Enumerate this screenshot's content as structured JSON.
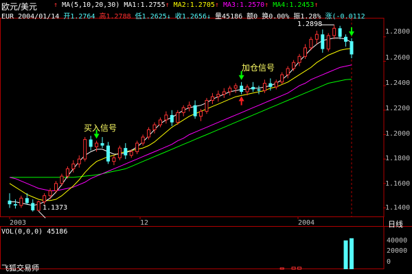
{
  "header": {
    "title": "欧元/美元",
    "ma_label": "MA(5,10,20,30)",
    "ma1": "MA1:1.2755",
    "ma2": "MA2:1.2705",
    "ma3": "MA3:1.2570",
    "ma4": "MA4:1.2453",
    "symbol": "EUR",
    "date": "2004/01/14",
    "open": "开1.2764",
    "high": "高1.2788",
    "low": "低1.2625",
    "close": "收1.2656",
    "volume": "量45186",
    "amount": "额0",
    "turnover": "换0.00%",
    "amplitude": "振1.28%",
    "change": "涨(-0.0112"
  },
  "price_axis": [
    "1.2800",
    "1.2600",
    "1.2400",
    "1.2200",
    "1.2000",
    "1.1800",
    "1.1600",
    "1.1400"
  ],
  "annotations": {
    "buy": "买入信号",
    "add": "加仓信号",
    "high_mark": "1.2898",
    "low_mark": "1.1373"
  },
  "x_axis": [
    "2003",
    "12",
    "2004"
  ],
  "period": "日线",
  "volume_panel": {
    "label": "VOL(0,0,0)",
    "value": "45186",
    "axis": [
      "40000",
      "20000",
      "0"
    ]
  },
  "footer": "飞狐交易师",
  "colors": {
    "up": "#ff3232",
    "down": "#54fcfc",
    "ma1": "#ffffff",
    "ma2": "#ffff00",
    "ma3": "#ff00ff",
    "ma4": "#00ff00",
    "frame": "#b00000"
  },
  "chart_data": {
    "type": "candlestick",
    "ylim": [
      1.133,
      1.295
    ],
    "ohlc": [
      [
        1.146,
        1.152,
        1.14,
        1.143
      ],
      [
        1.143,
        1.147,
        1.1395,
        1.142
      ],
      [
        1.142,
        1.15,
        1.14,
        1.148
      ],
      [
        1.148,
        1.152,
        1.143,
        1.144
      ],
      [
        1.144,
        1.147,
        1.137,
        1.138
      ],
      [
        1.138,
        1.146,
        1.1373,
        1.145
      ],
      [
        1.145,
        1.152,
        1.143,
        1.15
      ],
      [
        1.15,
        1.156,
        1.147,
        1.154
      ],
      [
        1.154,
        1.162,
        1.152,
        1.16
      ],
      [
        1.16,
        1.168,
        1.158,
        1.166
      ],
      [
        1.166,
        1.174,
        1.164,
        1.172
      ],
      [
        1.172,
        1.179,
        1.169,
        1.176
      ],
      [
        1.176,
        1.183,
        1.173,
        1.18
      ],
      [
        1.18,
        1.198,
        1.178,
        1.196
      ],
      [
        1.196,
        1.199,
        1.187,
        1.19
      ],
      [
        1.19,
        1.195,
        1.186,
        1.193
      ],
      [
        1.193,
        1.198,
        1.189,
        1.191
      ],
      [
        1.191,
        1.194,
        1.176,
        1.178
      ],
      [
        1.178,
        1.183,
        1.175,
        1.181
      ],
      [
        1.181,
        1.191,
        1.179,
        1.189
      ],
      [
        1.189,
        1.193,
        1.18,
        1.183
      ],
      [
        1.183,
        1.188,
        1.181,
        1.186
      ],
      [
        1.186,
        1.195,
        1.184,
        1.193
      ],
      [
        1.193,
        1.2,
        1.191,
        1.198
      ],
      [
        1.198,
        1.206,
        1.196,
        1.204
      ],
      [
        1.204,
        1.21,
        1.201,
        1.208
      ],
      [
        1.208,
        1.214,
        1.206,
        1.212
      ],
      [
        1.212,
        1.219,
        1.209,
        1.216
      ],
      [
        1.216,
        1.22,
        1.207,
        1.21
      ],
      [
        1.21,
        1.22,
        1.208,
        1.218
      ],
      [
        1.218,
        1.224,
        1.215,
        1.222
      ],
      [
        1.222,
        1.227,
        1.219,
        1.224
      ],
      [
        1.224,
        1.228,
        1.213,
        1.215
      ],
      [
        1.215,
        1.221,
        1.211,
        1.219
      ],
      [
        1.219,
        1.23,
        1.217,
        1.228
      ],
      [
        1.228,
        1.234,
        1.225,
        1.231
      ],
      [
        1.231,
        1.236,
        1.227,
        1.233
      ],
      [
        1.233,
        1.238,
        1.23,
        1.235
      ],
      [
        1.235,
        1.24,
        1.232,
        1.238
      ],
      [
        1.238,
        1.242,
        1.234,
        1.24
      ],
      [
        1.24,
        1.243,
        1.233,
        1.235
      ],
      [
        1.235,
        1.241,
        1.232,
        1.239
      ],
      [
        1.239,
        1.243,
        1.235,
        1.237
      ],
      [
        1.237,
        1.24,
        1.233,
        1.236
      ],
      [
        1.236,
        1.245,
        1.234,
        1.242
      ],
      [
        1.242,
        1.246,
        1.236,
        1.239
      ],
      [
        1.239,
        1.245,
        1.237,
        1.243
      ],
      [
        1.243,
        1.251,
        1.241,
        1.249
      ],
      [
        1.249,
        1.256,
        1.246,
        1.254
      ],
      [
        1.254,
        1.261,
        1.252,
        1.259
      ],
      [
        1.259,
        1.266,
        1.256,
        1.264
      ],
      [
        1.264,
        1.274,
        1.262,
        1.271
      ],
      [
        1.271,
        1.28,
        1.269,
        1.278
      ],
      [
        1.278,
        1.285,
        1.274,
        1.282
      ],
      [
        1.282,
        1.286,
        1.267,
        1.27
      ],
      [
        1.27,
        1.283,
        1.268,
        1.281
      ],
      [
        1.281,
        1.2898,
        1.278,
        1.287
      ],
      [
        1.287,
        1.289,
        1.278,
        1.28
      ],
      [
        1.28,
        1.282,
        1.272,
        1.276
      ],
      [
        1.2764,
        1.2788,
        1.2625,
        1.2656
      ]
    ],
    "ma1": [
      1.145,
      1.145,
      1.144,
      1.143,
      1.142,
      1.143,
      1.145,
      1.148,
      1.153,
      1.159,
      1.166,
      1.172,
      1.178,
      1.183,
      1.186,
      1.188,
      1.188,
      1.186,
      1.184,
      1.184,
      1.185,
      1.187,
      1.19,
      1.194,
      1.199,
      1.204,
      1.209,
      1.212,
      1.214,
      1.217,
      1.22,
      1.222,
      1.223,
      1.224,
      1.226,
      1.229,
      1.231,
      1.233,
      1.235,
      1.236,
      1.237,
      1.237,
      1.238,
      1.238,
      1.239,
      1.24,
      1.242,
      1.245,
      1.249,
      1.254,
      1.26,
      1.265,
      1.27,
      1.274,
      1.277,
      1.278,
      1.279,
      1.279,
      1.278,
      1.2755
    ],
    "ma2": [
      1.16,
      1.157,
      1.154,
      1.151,
      1.149,
      1.147,
      1.146,
      1.146,
      1.147,
      1.15,
      1.154,
      1.158,
      1.163,
      1.169,
      1.174,
      1.178,
      1.18,
      1.182,
      1.183,
      1.185,
      1.186,
      1.187,
      1.188,
      1.189,
      1.191,
      1.194,
      1.198,
      1.202,
      1.206,
      1.209,
      1.212,
      1.215,
      1.217,
      1.219,
      1.221,
      1.223,
      1.225,
      1.227,
      1.229,
      1.231,
      1.232,
      1.233,
      1.234,
      1.235,
      1.236,
      1.238,
      1.239,
      1.241,
      1.243,
      1.246,
      1.249,
      1.252,
      1.255,
      1.259,
      1.262,
      1.265,
      1.267,
      1.269,
      1.27,
      1.2705
    ],
    "ma3": [
      1.165,
      1.164,
      1.162,
      1.16,
      1.158,
      1.156,
      1.155,
      1.154,
      1.154,
      1.155,
      1.156,
      1.157,
      1.159,
      1.161,
      1.164,
      1.166,
      1.168,
      1.17,
      1.172,
      1.174,
      1.176,
      1.178,
      1.18,
      1.182,
      1.184,
      1.186,
      1.188,
      1.19,
      1.192,
      1.195,
      1.197,
      1.2,
      1.202,
      1.204,
      1.206,
      1.208,
      1.21,
      1.212,
      1.214,
      1.216,
      1.218,
      1.22,
      1.222,
      1.224,
      1.226,
      1.228,
      1.23,
      1.232,
      1.234,
      1.237,
      1.24,
      1.242,
      1.245,
      1.247,
      1.249,
      1.251,
      1.253,
      1.255,
      1.256,
      1.257
    ],
    "ma4": [
      1.165,
      1.165,
      1.165,
      1.165,
      1.165,
      1.165,
      1.165,
      1.165,
      1.165,
      1.165,
      1.165,
      1.165,
      1.1655,
      1.166,
      1.1665,
      1.167,
      1.168,
      1.169,
      1.17,
      1.171,
      1.172,
      1.174,
      1.176,
      1.178,
      1.18,
      1.182,
      1.184,
      1.186,
      1.188,
      1.19,
      1.192,
      1.194,
      1.196,
      1.198,
      1.2,
      1.202,
      1.204,
      1.206,
      1.208,
      1.21,
      1.212,
      1.214,
      1.216,
      1.218,
      1.22,
      1.222,
      1.224,
      1.226,
      1.228,
      1.23,
      1.232,
      1.234,
      1.236,
      1.238,
      1.24,
      1.242,
      1.243,
      1.244,
      1.245,
      1.2453
    ],
    "volume": [
      0,
      0,
      0,
      0,
      0,
      0,
      0,
      0,
      0,
      0,
      0,
      0,
      0,
      0,
      0,
      0,
      0,
      0,
      0,
      0,
      0,
      0,
      0,
      0,
      0,
      0,
      0,
      0,
      0,
      0,
      0,
      0,
      0,
      0,
      0,
      0,
      0,
      0,
      0,
      0,
      0,
      0,
      0,
      0,
      0,
      0,
      0,
      2000,
      0,
      3000,
      3000,
      0,
      0,
      0,
      0,
      0,
      0,
      0,
      42000,
      45186
    ],
    "buy_signal_index": 15,
    "add_signal_index": 40,
    "vol_ylim": [
      0,
      50000
    ]
  }
}
